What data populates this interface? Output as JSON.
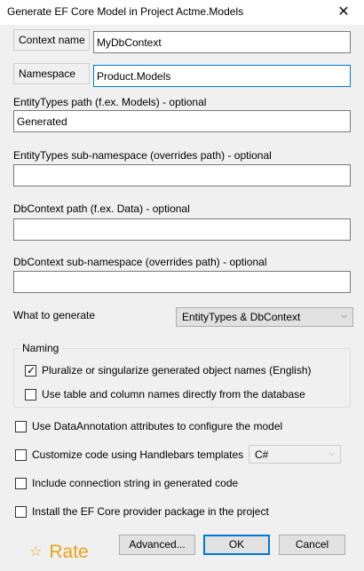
{
  "window": {
    "title": "Generate EF Core Model in Project Actme.Models",
    "close_glyph": "✕"
  },
  "context_name": {
    "label": "Context name",
    "value": "MyDbContext"
  },
  "namespace": {
    "label": "Namespace",
    "value": "Product.Models"
  },
  "entity_types_path": {
    "label": "EntityTypes path (f.ex. Models) - optional",
    "value": "Generated"
  },
  "entity_types_subnamespace": {
    "label": "EntityTypes sub-namespace (overrides path) - optional",
    "value": ""
  },
  "dbcontext_path": {
    "label": "DbContext path (f.ex. Data) - optional",
    "value": ""
  },
  "dbcontext_subnamespace": {
    "label": "DbContext sub-namespace (overrides path) - optional",
    "value": ""
  },
  "what_to_generate": {
    "label": "What to generate",
    "selected": "EntityTypes & DbContext"
  },
  "naming": {
    "title": "Naming",
    "pluralize": {
      "label": "Pluralize or singularize generated object names (English)",
      "checked": true
    },
    "use_db_names": {
      "label": "Use table and column names directly from the database",
      "checked": false
    }
  },
  "options": {
    "data_annotations": {
      "label": "Use DataAnnotation attributes to configure the model",
      "checked": false
    },
    "handlebars": {
      "label": "Customize code using Handlebars templates",
      "checked": false,
      "language": "C#"
    },
    "connection_string": {
      "label": "Include connection string in generated code",
      "checked": false
    },
    "install_provider": {
      "label": "Install the EF Core provider package in the project",
      "checked": false
    }
  },
  "footer": {
    "rate_star": "☆",
    "rate_label": "Rate",
    "advanced_label": "Advanced...",
    "ok_label": "OK",
    "cancel_label": "Cancel"
  },
  "colors": {
    "accent": "#0078d7",
    "rate": "#e8a317",
    "dialog_bg": "#f0f0f0"
  }
}
